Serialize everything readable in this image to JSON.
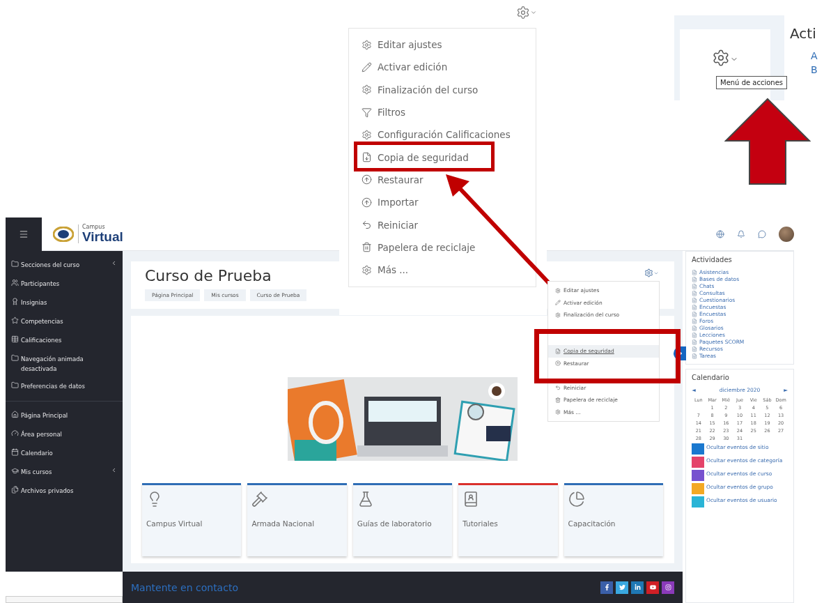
{
  "action_menu_zoom": {
    "items": [
      {
        "label": "Editar ajustes",
        "kind": "gear"
      },
      {
        "label": "Activar edición",
        "kind": "pencil"
      },
      {
        "label": "Finalización del curso",
        "kind": "gear"
      },
      {
        "label": "Filtros",
        "kind": "filter"
      },
      {
        "label": "Configuración Calificaciones",
        "kind": "gear"
      },
      {
        "label": "Copia de seguridad",
        "kind": "file"
      },
      {
        "label": "Restaurar",
        "kind": "upload"
      },
      {
        "label": "Importar",
        "kind": "upload"
      },
      {
        "label": "Reiniciar",
        "kind": "undo"
      },
      {
        "label": "Papelera de reciclaje",
        "kind": "trash"
      },
      {
        "label": "Más ...",
        "kind": "gear"
      }
    ]
  },
  "actions_inset": {
    "heading": "Acti",
    "links": [
      "A",
      "B"
    ],
    "tooltip": "Menú de acciones"
  },
  "header": {
    "logo_small": "Campus",
    "logo_big": "Virtual"
  },
  "sidebar": {
    "groups": [
      [
        {
          "label": "Secciones del curso",
          "kind": "folder",
          "expandable": true
        },
        {
          "label": "Participantes",
          "kind": "users",
          "expandable": false
        },
        {
          "label": "Insignias",
          "kind": "badge",
          "expandable": false
        },
        {
          "label": "Competencias",
          "kind": "star",
          "expandable": false
        },
        {
          "label": "Calificaciones",
          "kind": "grades",
          "expandable": false
        },
        {
          "label": "Navegación animada desactivada",
          "kind": "folder",
          "expandable": false
        },
        {
          "label": "Preferencias de datos",
          "kind": "folder",
          "expandable": false
        }
      ],
      [
        {
          "label": "Página Principal",
          "kind": "home",
          "expandable": false
        },
        {
          "label": "Área personal",
          "kind": "gauge",
          "expandable": false
        },
        {
          "label": "Calendario",
          "kind": "calendar",
          "expandable": false
        },
        {
          "label": "Mis cursos",
          "kind": "cap",
          "expandable": true
        },
        {
          "label": "Archivos privados",
          "kind": "files",
          "expandable": false
        }
      ]
    ]
  },
  "course": {
    "title": "Curso de Prueba",
    "breadcrumb": [
      "Página Principal",
      "Mis cursos",
      "Curso de Prueba"
    ]
  },
  "course_action_menu": {
    "items": [
      {
        "label": "Editar ajustes",
        "kind": "gear",
        "selected": false
      },
      {
        "label": "Activar edición",
        "kind": "pencil",
        "selected": false
      },
      {
        "label": "Finalización del curso",
        "kind": "gear",
        "selected": false
      },
      {
        "kind": "blank"
      },
      {
        "kind": "blank"
      },
      {
        "label": "Copia de seguridad",
        "kind": "file",
        "selected": true
      },
      {
        "label": "Restaurar",
        "kind": "upload",
        "selected": false
      },
      {
        "kind": "blank"
      },
      {
        "label": "Reiniciar",
        "kind": "undo",
        "selected": false
      },
      {
        "label": "Papelera de reciclaje",
        "kind": "trash",
        "selected": false
      },
      {
        "label": "Más ...",
        "kind": "gear",
        "selected": false
      }
    ]
  },
  "tiles": [
    {
      "label": "Campus Virtual",
      "kind": "bulb",
      "color": "#2f6db5"
    },
    {
      "label": "Armada Nacional",
      "kind": "gavel",
      "color": "#2f6db5"
    },
    {
      "label": "Guías de laboratorio",
      "kind": "flask",
      "color": "#2f6db5"
    },
    {
      "label": "Tutoriales",
      "kind": "contacts",
      "color": "#d9302c"
    },
    {
      "label": "Capacitación",
      "kind": "pie",
      "color": "#2f6db5"
    }
  ],
  "activities": {
    "title": "Actividades",
    "items": [
      "Asistencias",
      "Bases de datos",
      "Chats",
      "Consultas",
      "Cuestionarios",
      "Encuestas",
      "Encuestas",
      "Foros",
      "Glosarios",
      "Lecciones",
      "Paquetes SCORM",
      "Recursos",
      "Tareas"
    ]
  },
  "calendar": {
    "title": "Calendario",
    "prev": "◄",
    "month": "diciembre 2020",
    "next": "►",
    "weekdays": [
      "Lun",
      "Mar",
      "Mié",
      "Jue",
      "Vie",
      "Sáb",
      "Dom"
    ],
    "weeks": [
      {
        "kind": "end_aligned",
        "days": [
          "1",
          "2",
          "3",
          "4",
          "5",
          "6"
        ]
      },
      {
        "kind": "start_aligned",
        "days": [
          "7",
          "8",
          "9",
          "10",
          "11",
          "12",
          "13"
        ]
      },
      {
        "kind": "start_aligned",
        "days": [
          "14",
          "15",
          "16",
          "17",
          "18",
          "19",
          "20"
        ]
      },
      {
        "kind": "start_aligned",
        "days": [
          "21",
          "22",
          "23",
          "24",
          "25",
          "26",
          "27"
        ]
      },
      {
        "kind": "start_aligned",
        "days": [
          "28",
          "29",
          "30",
          "31"
        ]
      }
    ],
    "legend": [
      {
        "label": "Ocultar eventos de sitio",
        "color": "#1a78cf"
      },
      {
        "label": "Ocultar eventos de categoría",
        "color": "#e4436a"
      },
      {
        "label": "Ocultar eventos de curso",
        "color": "#7651cf"
      },
      {
        "label": "Ocultar eventos de grupo",
        "color": "#f3a924"
      },
      {
        "label": "Ocultar eventos de usuario",
        "color": "#2ab4d6"
      }
    ]
  },
  "footer": {
    "contact": "Mantente en contacto",
    "social": [
      {
        "kind": "facebook",
        "color": "#3b5fa8"
      },
      {
        "kind": "twitter",
        "color": "#3aa8e0"
      },
      {
        "kind": "linkedin",
        "color": "#1f78b4"
      },
      {
        "kind": "youtube",
        "color": "#d01f26"
      },
      {
        "kind": "instagram",
        "color": "#8a3ab9"
      }
    ]
  }
}
